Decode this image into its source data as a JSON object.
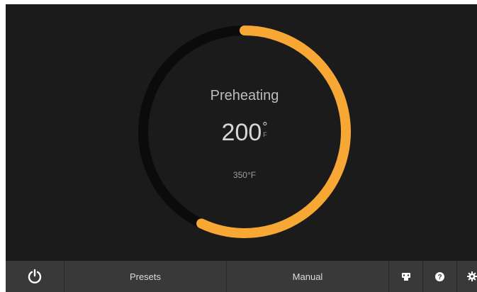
{
  "oven": {
    "status": "Preheating",
    "current_temp": "200",
    "degree_symbol": "°",
    "unit": "F",
    "target_temp": "350°F",
    "preheat_progress": 0.57,
    "colors": {
      "progress": "#f7a733",
      "track": "#0b0b0b",
      "background": "#1c1b1b",
      "bar": "#3a3939"
    }
  },
  "toolbar": {
    "power_icon": "power-icon",
    "presets_label": "Presets",
    "manual_label": "Manual",
    "oven_icon": "oven-settings-icon",
    "help_icon": "help-icon",
    "settings_icon": "gear-icon"
  }
}
